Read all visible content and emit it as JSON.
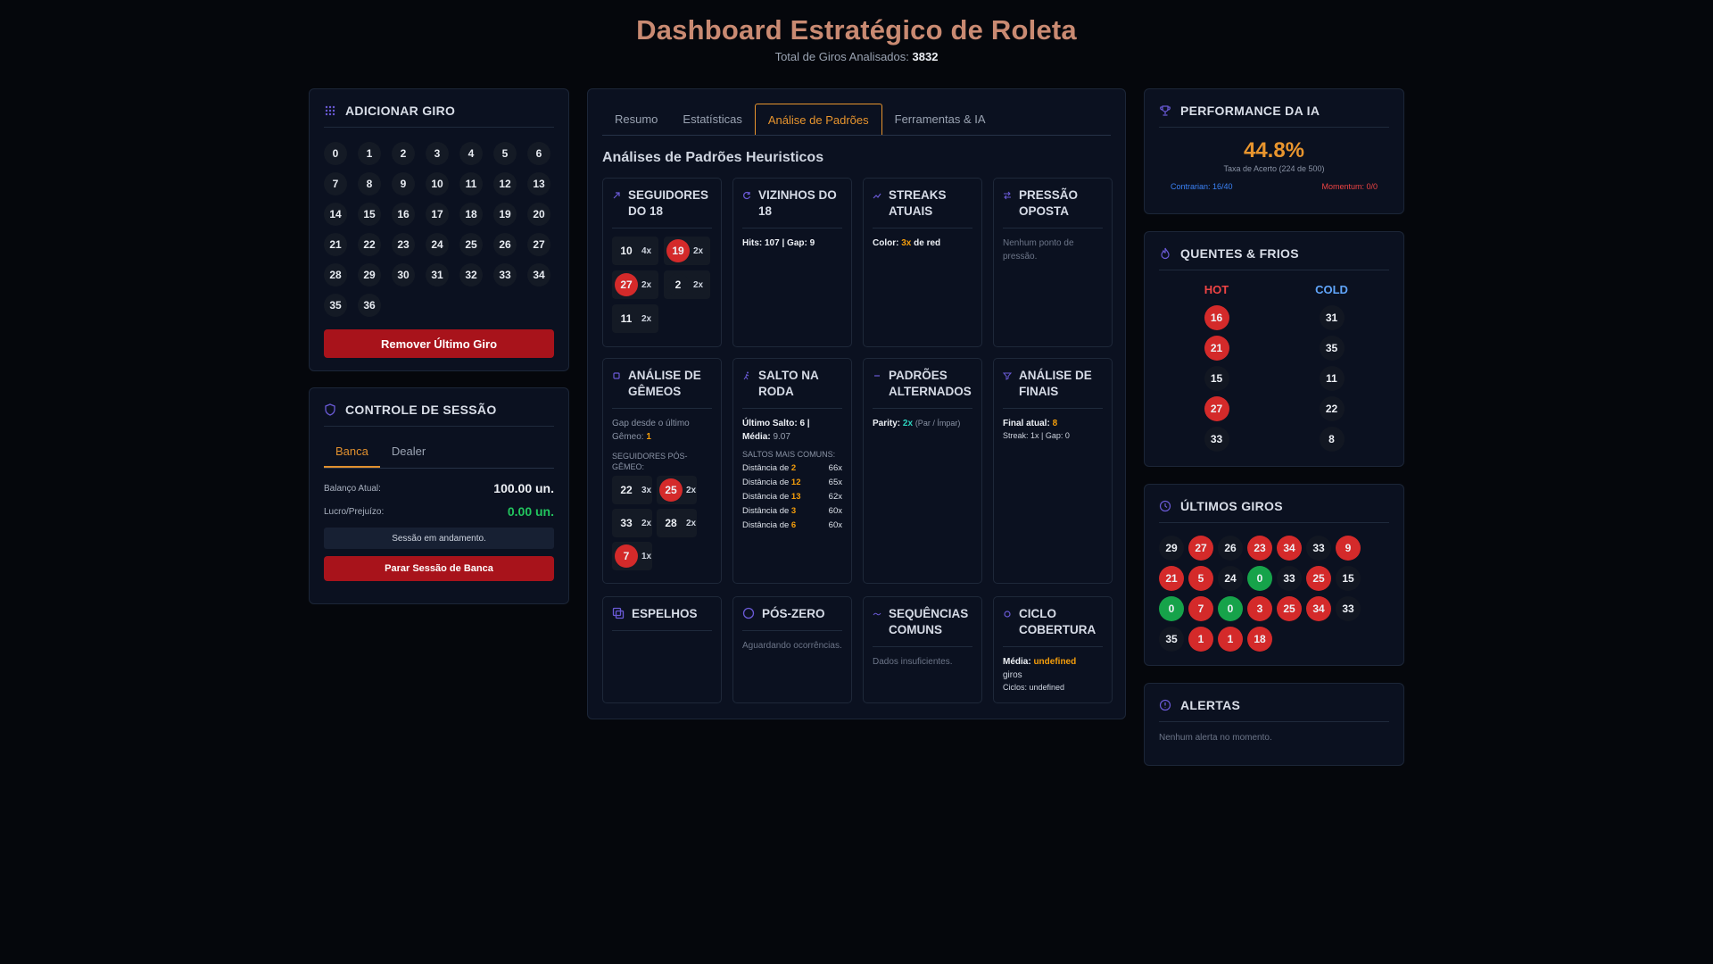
{
  "header": {
    "title": "Dashboard Estratégico de Roleta",
    "subtitle_label": "Total de Giros Analisados:",
    "total_spins": "3832"
  },
  "add_spin": {
    "title": "ADICIONAR GIRO",
    "numbers": [
      "0",
      "1",
      "2",
      "3",
      "4",
      "5",
      "6",
      "7",
      "8",
      "9",
      "10",
      "11",
      "12",
      "13",
      "14",
      "15",
      "16",
      "17",
      "18",
      "19",
      "20",
      "21",
      "22",
      "23",
      "24",
      "25",
      "26",
      "27",
      "28",
      "29",
      "30",
      "31",
      "32",
      "33",
      "34",
      "35",
      "36"
    ],
    "remove_label": "Remover Último Giro"
  },
  "session": {
    "title": "CONTROLE DE SESSÃO",
    "tabs": [
      "Banca",
      "Dealer"
    ],
    "balance_label": "Balanço Atual:",
    "balance_value": "100.00 un.",
    "profit_label": "Lucro/Prejuízo:",
    "profit_value": "0.00 un.",
    "status": "Sessão em andamento.",
    "stop_label": "Parar Sessão de Banca"
  },
  "main": {
    "tabs": [
      "Resumo",
      "Estatísticas",
      "Análise de Padrões",
      "Ferramentas & IA"
    ],
    "active_tab": "Análise de Padrões",
    "section_title": "Análises de Padrões Heuristicos",
    "cards": {
      "followers18": {
        "title": "SEGUIDORES DO 18",
        "chips": [
          {
            "n": "10",
            "c": "4x",
            "color": "black"
          },
          {
            "n": "19",
            "c": "2x",
            "color": "red"
          },
          {
            "n": "27",
            "c": "2x",
            "color": "red"
          },
          {
            "n": "2",
            "c": "2x",
            "color": "black"
          },
          {
            "n": "11",
            "c": "2x",
            "color": "black"
          }
        ]
      },
      "neighbors18": {
        "title": "VIZINHOS DO 18",
        "text": "Hits: 107 | Gap: 9"
      },
      "streaks": {
        "title": "STREAKS ATUAIS",
        "label": "Color:",
        "value": "3x",
        "suffix": "de red"
      },
      "pressure": {
        "title": "PRESSÃO OPOSTA",
        "text": "Nenhum ponto de pressão."
      },
      "twins": {
        "title": "ANÁLISE DE GÊMEOS",
        "gap_label": "Gap desde o último Gêmeo:",
        "gap_value": "1",
        "sub_label": "SEGUIDORES PÓS-GÊMEO:",
        "chips": [
          {
            "n": "22",
            "c": "3x",
            "color": "black"
          },
          {
            "n": "25",
            "c": "2x",
            "color": "red"
          },
          {
            "n": "33",
            "c": "2x",
            "color": "black"
          },
          {
            "n": "28",
            "c": "2x",
            "color": "black"
          },
          {
            "n": "7",
            "c": "1x",
            "color": "red"
          }
        ]
      },
      "jump": {
        "title": "SALTO NA RODA",
        "last_label": "Último Salto:",
        "last_value": "6 |",
        "avg_label": "Média:",
        "avg_value": "9.07",
        "sub_label": "SALTOS MAIS COMUNS:",
        "rows": [
          {
            "label": "Distância de",
            "d": "2",
            "c": "66x"
          },
          {
            "label": "Distância de",
            "d": "12",
            "c": "65x"
          },
          {
            "label": "Distância de",
            "d": "13",
            "c": "62x"
          },
          {
            "label": "Distância de",
            "d": "3",
            "c": "60x"
          },
          {
            "label": "Distância de",
            "d": "6",
            "c": "60x"
          }
        ]
      },
      "alternating": {
        "title": "PADRÕES ALTERNADOS",
        "label": "Parity:",
        "value": "2x",
        "note": "(Par / Ímpar)"
      },
      "endings": {
        "title": "ANÁLISE DE FINAIS",
        "label": "Final atual:",
        "value": "8",
        "line2": "Streak: 1x | Gap: 0"
      },
      "mirrors": {
        "title": "ESPELHOS"
      },
      "postzero": {
        "title": "PÓS-ZERO",
        "text": "Aguardando ocorrências."
      },
      "sequences": {
        "title": "SEQUÊNCIAS COMUNS",
        "text": "Dados insuficientes."
      },
      "cycle": {
        "title": "CICLO COBERTURA",
        "avg_label": "Média:",
        "avg_value": "undefined",
        "avg_suffix": "giros",
        "cycles": "Ciclos: undefined"
      }
    }
  },
  "performance": {
    "title": "PERFORMANCE DA IA",
    "rate": "44.8%",
    "rate_label": "Taxa de Acerto (224 de 500)",
    "contrarian": "Contrarian: 16/40",
    "momentum": "Momentum: 0/0"
  },
  "hotcold": {
    "title": "QUENTES & FRIOS",
    "hot_label": "HOT",
    "cold_label": "COLD",
    "hot": [
      {
        "n": "16",
        "color": "red"
      },
      {
        "n": "21",
        "color": "red"
      },
      {
        "n": "15",
        "color": "black"
      },
      {
        "n": "27",
        "color": "red"
      },
      {
        "n": "33",
        "color": "black"
      }
    ],
    "cold": [
      {
        "n": "31",
        "color": "black"
      },
      {
        "n": "35",
        "color": "black"
      },
      {
        "n": "11",
        "color": "black"
      },
      {
        "n": "22",
        "color": "black"
      },
      {
        "n": "8",
        "color": "black"
      }
    ]
  },
  "recent": {
    "title": "ÚLTIMOS GIROS",
    "spins": [
      {
        "n": "29",
        "color": "black"
      },
      {
        "n": "27",
        "color": "red"
      },
      {
        "n": "26",
        "color": "black"
      },
      {
        "n": "23",
        "color": "red"
      },
      {
        "n": "34",
        "color": "red"
      },
      {
        "n": "33",
        "color": "black"
      },
      {
        "n": "9",
        "color": "red"
      },
      {
        "n": "21",
        "color": "red"
      },
      {
        "n": "5",
        "color": "red"
      },
      {
        "n": "24",
        "color": "black"
      },
      {
        "n": "0",
        "color": "green"
      },
      {
        "n": "33",
        "color": "black"
      },
      {
        "n": "25",
        "color": "red"
      },
      {
        "n": "15",
        "color": "black"
      },
      {
        "n": "0",
        "color": "green"
      },
      {
        "n": "7",
        "color": "red"
      },
      {
        "n": "0",
        "color": "green"
      },
      {
        "n": "3",
        "color": "red"
      },
      {
        "n": "25",
        "color": "red"
      },
      {
        "n": "34",
        "color": "red"
      },
      {
        "n": "33",
        "color": "black"
      },
      {
        "n": "35",
        "color": "black"
      },
      {
        "n": "1",
        "color": "red"
      },
      {
        "n": "1",
        "color": "red"
      },
      {
        "n": "18",
        "color": "red"
      }
    ]
  },
  "alerts": {
    "title": "ALERTAS",
    "text": "Nenhum alerta no momento."
  },
  "colors": {
    "accent": "#e8952e",
    "red": "#d42a2a",
    "green": "#16a34a",
    "title": "#c98a72",
    "icon": "#6a5ad6"
  }
}
